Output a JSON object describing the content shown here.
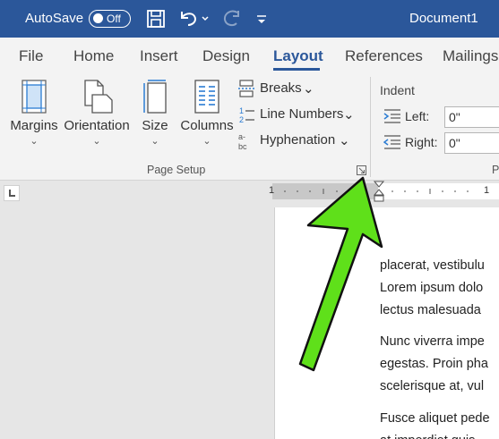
{
  "titlebar": {
    "autosave_label": "AutoSave",
    "autosave_state": "Off",
    "document_title": "Document1",
    "icons": [
      "save-icon",
      "undo-icon",
      "redo-icon",
      "customize-qat-icon"
    ]
  },
  "tabs": [
    {
      "label": "File"
    },
    {
      "label": "Home"
    },
    {
      "label": "Insert"
    },
    {
      "label": "Design"
    },
    {
      "label": "Layout",
      "active": true
    },
    {
      "label": "References"
    },
    {
      "label": "Mailings"
    }
  ],
  "page_setup": {
    "margins": "Margins",
    "orientation": "Orientation",
    "size": "Size",
    "columns": "Columns",
    "breaks": "Breaks",
    "line_numbers": "Line Numbers",
    "hyphenation": "Hyphenation",
    "group_label": "Page Setup"
  },
  "indent": {
    "title": "Indent",
    "left_label": "Left:",
    "left_value": "0\"",
    "right_label": "Right:",
    "right_value": "0\"",
    "next_group_letter": "P"
  },
  "ruler": {
    "left_number": "1",
    "right_number": "1"
  },
  "document": {
    "paragraphs": [
      [
        "placerat, vestibulu",
        "Lorem ipsum dolo",
        "lectus malesuada"
      ],
      [
        "Nunc viverra impe",
        "egestas. Proin pha",
        "scelerisque at, vul"
      ],
      [
        "Fusce aliquet pede",
        "at imperdiet quis"
      ]
    ]
  },
  "colors": {
    "title_bar": "#2b579a",
    "ribbon": "#f3f3f3",
    "annotation_arrow": "#5fe01a"
  }
}
